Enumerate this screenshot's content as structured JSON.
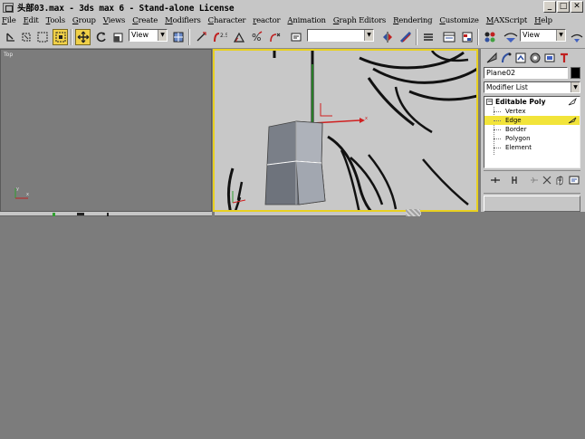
{
  "window": {
    "title": "头部03.max - 3ds max 6 - Stand-alone License",
    "min_label": "_",
    "max_label": "□",
    "close_label": "✕"
  },
  "menu": [
    {
      "label": "File"
    },
    {
      "label": "Edit"
    },
    {
      "label": "Tools"
    },
    {
      "label": "Group"
    },
    {
      "label": "Views"
    },
    {
      "label": "Create"
    },
    {
      "label": "Modifiers"
    },
    {
      "label": "Character"
    },
    {
      "label": "reactor"
    },
    {
      "label": "Animation"
    },
    {
      "label": "Graph Editors"
    },
    {
      "label": "Rendering"
    },
    {
      "label": "Customize"
    },
    {
      "label": "MAXScript"
    },
    {
      "label": "Help"
    }
  ],
  "toolbar": {
    "ref_coord": "View",
    "named_selection": "",
    "view_dropdown": "View"
  },
  "viewports": {
    "top_label": "Top"
  },
  "command_panel": {
    "object_name": "Plane02",
    "modifier_list": "Modifier List",
    "stack_root": "Editable Poly",
    "stack_items": [
      {
        "label": "Vertex",
        "selected": false
      },
      {
        "label": "Edge",
        "selected": true
      },
      {
        "label": "Border",
        "selected": false
      },
      {
        "label": "Polygon",
        "selected": false
      },
      {
        "label": "Element",
        "selected": false
      }
    ]
  }
}
